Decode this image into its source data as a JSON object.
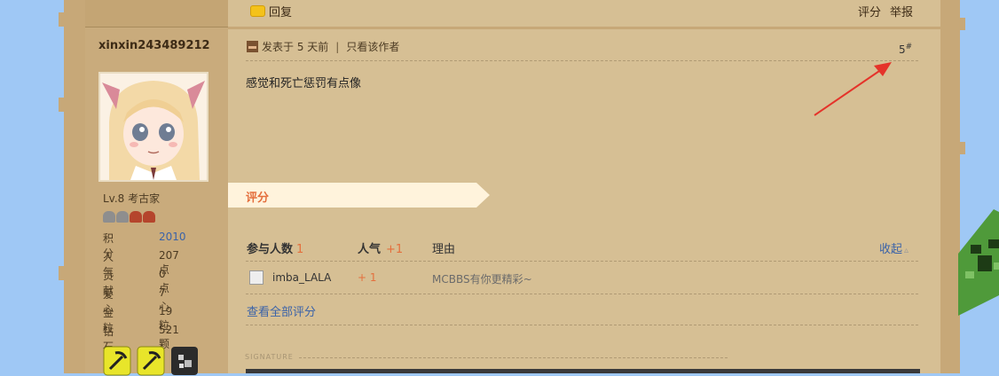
{
  "user": {
    "name": "xinxin243489212",
    "level": "Lv.8 考古家",
    "stats": [
      {
        "label": "积分",
        "value": "2010",
        "link": true
      },
      {
        "label": "人气",
        "value": "207 点",
        "link": false
      },
      {
        "label": "贡献",
        "value": "0 点",
        "link": false
      },
      {
        "label": "爱心",
        "value": "7 心",
        "link": false
      },
      {
        "label": "金粒",
        "value": "19 粒",
        "link": false
      },
      {
        "label": "钻石",
        "value": "521 颗",
        "link": false
      }
    ]
  },
  "toolbar": {
    "reply_label": "回复",
    "rate_label": "评分",
    "report_label": "举报"
  },
  "post": {
    "posted": "发表于 5 天前",
    "separator": "|",
    "author_only": "只看该作者",
    "floor": "5",
    "floor_mark": "#",
    "content": "感觉和死亡惩罚有点像"
  },
  "rating": {
    "section_title": "评分",
    "participants_label": "参与人数",
    "participants_count": "1",
    "popularity_label": "人气",
    "popularity_total": "+1",
    "reason_label": "理由",
    "collapse_label": "收起",
    "rows": [
      {
        "user": "imba_LALA",
        "points": "+ 1",
        "reason": "MCBBS有你更精彩~"
      }
    ],
    "view_all": "查看全部评分"
  },
  "signature_label": "SIGNATURE",
  "colors": {
    "accent": "#e46f3d",
    "link": "#3b63a8",
    "content_bg": "#d6bf94",
    "sidebar_bg": "#c9ab7c",
    "sky": "#9fc8f5"
  }
}
